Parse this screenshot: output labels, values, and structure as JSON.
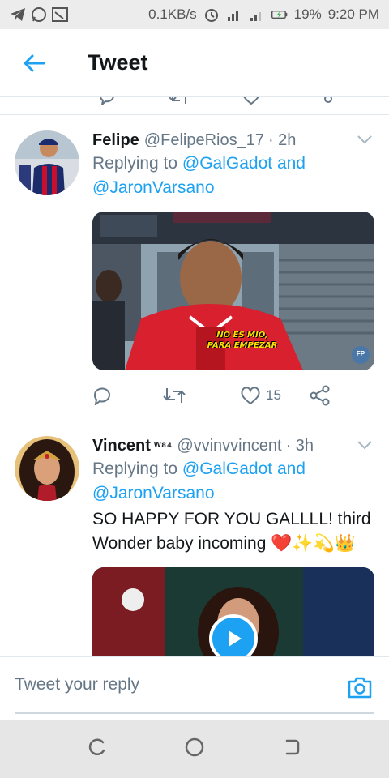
{
  "status_bar": {
    "net_speed": "0.1KB/s",
    "battery": "19%",
    "time": "9:20 PM"
  },
  "header": {
    "title": "Tweet"
  },
  "tweets": [
    {
      "name": "Felipe",
      "handle": "@FelipeRios_17",
      "time": "· 2h",
      "replying_prefix": "Replying to",
      "replying_users": "@GalGadot and @JaronVarsano",
      "media_caption_line1": "NO ES MIO,",
      "media_caption_line2": "PARA EMPEZAR",
      "media_badge": "FP",
      "likes": "15"
    },
    {
      "name": "Vincent",
      "name_suffix": "ᵂ⁸⁴",
      "handle": "@vvinvvincent",
      "time": "· 3h",
      "replying_prefix": "Replying to",
      "replying_users": "@GalGadot and @JaronVarsano",
      "text": "SO HAPPY FOR YOU GALLLL! third Wonder baby incoming ❤️✨💫👑"
    }
  ],
  "reply_bar": {
    "placeholder": "Tweet your reply"
  },
  "colors": {
    "accent": "#1da1f2",
    "muted": "#657786"
  }
}
